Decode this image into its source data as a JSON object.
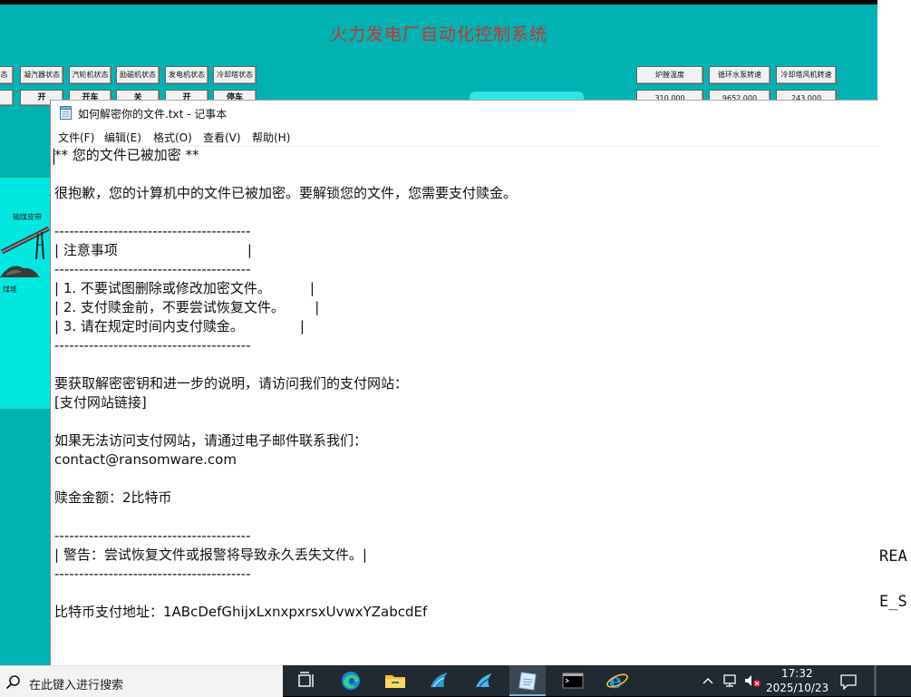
{
  "hmi": {
    "title": "火力发电厂自动化控制系统",
    "status_buttons": [
      "态",
      "凝汽器状态",
      "汽轮机状态",
      "励磁机状态",
      "发电机状态",
      "冷却塔状态"
    ],
    "control_buttons": [
      "",
      "开",
      "开车",
      "关",
      "开",
      "停车"
    ],
    "right_headers": [
      "炉膛温度",
      "循环水泵转速",
      "冷却塔风机转速"
    ],
    "right_values": [
      "310.000",
      "9652.000",
      "243.000"
    ],
    "conveyor_label": "输煤皮带",
    "coal_label": "煤堆"
  },
  "terminal_fragments": [
    "REA",
    "E_S"
  ],
  "notepad": {
    "title": "如何解密你的文件.txt - 记事本",
    "menu": [
      "文件(F)",
      "编辑(E)",
      "格式(O)",
      "查看(V)",
      "帮助(H)"
    ],
    "lines": [
      "** 您的文件已被加密 **",
      "",
      "很抱歉，您的计算机中的文件已被加密。要解锁您的文件，您需要支付赎金。",
      "",
      "----------------------------------------",
      "| 注意事项                              |",
      "----------------------------------------",
      "| 1. 不要试图删除或修改加密文件。         |",
      "| 2. 支付赎金前，不要尝试恢复文件。       |",
      "| 3. 请在规定时间内支付赎金。             |",
      "----------------------------------------",
      "",
      "要获取解密密钥和进一步的说明，请访问我们的支付网站：",
      "[支付网站链接]",
      "",
      "如果无法访问支付网站，请通过电子邮件联系我们：",
      "contact@ransomware.com",
      "",
      "赎金金额：2比特币",
      "",
      "----------------------------------------",
      "| 警告：尝试恢复文件或报警将导致永久丢失文件。|",
      "----------------------------------------",
      "",
      "比特币支付地址：1ABcDefGhijxLxnxpxrsxUvwxYZabcdEf"
    ]
  },
  "taskbar": {
    "search_placeholder": "在此键入进行搜索",
    "time": "17:32",
    "date": "2025/10/23",
    "apps": [
      "task-view-icon",
      "edge-icon",
      "file-explorer-icon",
      "app-shark-icon",
      "app-shark2-icon",
      "notepad-icon",
      "cmd-icon",
      "ie-icon"
    ]
  },
  "colors": {
    "hmi_bg": "#00b2b2",
    "hmi_title": "#d03030",
    "taskbar_dark": "#1f2a33"
  }
}
